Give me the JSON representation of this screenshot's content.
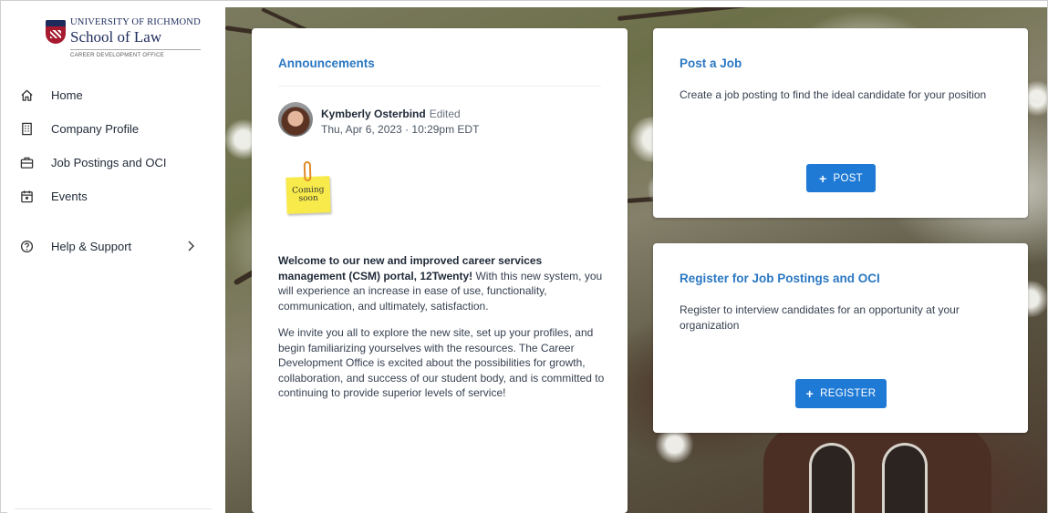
{
  "logo": {
    "line1": "UNIVERSITY OF RICHMOND",
    "line2": "School of Law",
    "line3": "CAREER DEVELOPMENT OFFICE"
  },
  "sidebar": {
    "items": [
      {
        "label": "Home",
        "icon": "home-icon"
      },
      {
        "label": "Company Profile",
        "icon": "building-icon"
      },
      {
        "label": "Job Postings and OCI",
        "icon": "briefcase-icon"
      },
      {
        "label": "Events",
        "icon": "calendar-icon"
      },
      {
        "label": "Help & Support",
        "icon": "help-circle-icon"
      }
    ]
  },
  "announcements": {
    "title": "Announcements",
    "author": "Kymberly Osterbind",
    "edited": "Edited",
    "date": "Thu, Apr 6, 2023 · 10:29pm EDT",
    "sticky_line1": "Coming",
    "sticky_line2": "soon",
    "p1_bold": "Welcome to our new and improved career services management (CSM) portal, 12Twenty!",
    "p1_rest": " With this new system, you will experience an increase in ease of use, functionality, communication, and ultimately, satisfaction.",
    "p2": "We invite you all to explore the new site, set up your profiles, and begin familiarizing yourselves with the resources. The Career Development Office is excited about the possibilities for growth, collaboration, and success of our student body, and is committed to continuing to provide superior levels of service!"
  },
  "post_job": {
    "title": "Post a Job",
    "description": "Create a job posting to find the ideal candidate for your position",
    "button": "POST"
  },
  "register": {
    "title": "Register for Job Postings and OCI",
    "description": "Register to interview candidates for an opportunity at your organization",
    "button": "REGISTER"
  },
  "colors": {
    "accent": "#2b78c2",
    "button": "#1f7ad6"
  }
}
